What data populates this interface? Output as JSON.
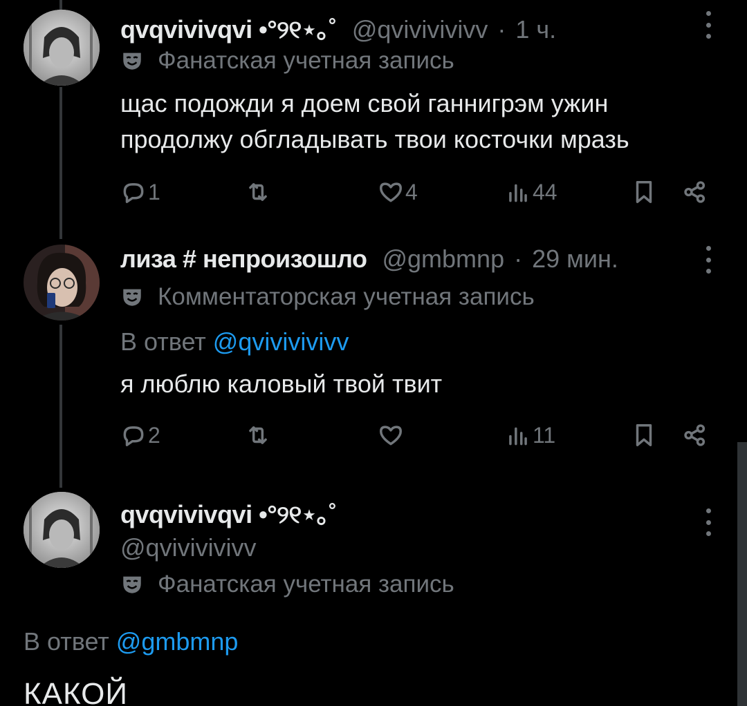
{
  "tweets": [
    {
      "display_name": "qvqvivivqvi •°୨୧⋆｡˚",
      "handle": "@qvivivivivv",
      "time": "1 ч.",
      "badge": "Фанатская учетная запись",
      "text_lines": [
        "щас подожди я доем свой ганнигрэм ужин",
        "продолжу обгладывать твои косточки мразь"
      ],
      "replies": "1",
      "retweets": "",
      "likes": "4",
      "views": "44"
    },
    {
      "display_name": "лиза # непроизошло",
      "handle": "@gmbmnp",
      "time": "29 мин.",
      "badge": "Комментаторская учетная запись",
      "reply_prefix": "В ответ",
      "reply_mention": "@qvivivivivv",
      "text_lines": [
        "я люблю каловый твой твит"
      ],
      "replies": "2",
      "retweets": "",
      "likes": "",
      "views": "11"
    }
  ],
  "focused": {
    "display_name": "qvqvivivqvi •°୨୧⋆｡˚",
    "handle": "@qvivivivivv",
    "badge": "Фанатская учетная запись",
    "reply_prefix": "В ответ",
    "reply_mention": "@gmbmnp",
    "text": "КАКОЙ"
  },
  "colors": {
    "background": "#000000",
    "text": "#e7e9ea",
    "muted": "#71767b",
    "accent": "#1d9bf0",
    "thread_line": "#333639"
  },
  "icons": [
    "reply-icon",
    "retweet-icon",
    "like-icon",
    "views-icon",
    "bookmark-icon",
    "share-icon",
    "more-icon",
    "mask-icon"
  ]
}
